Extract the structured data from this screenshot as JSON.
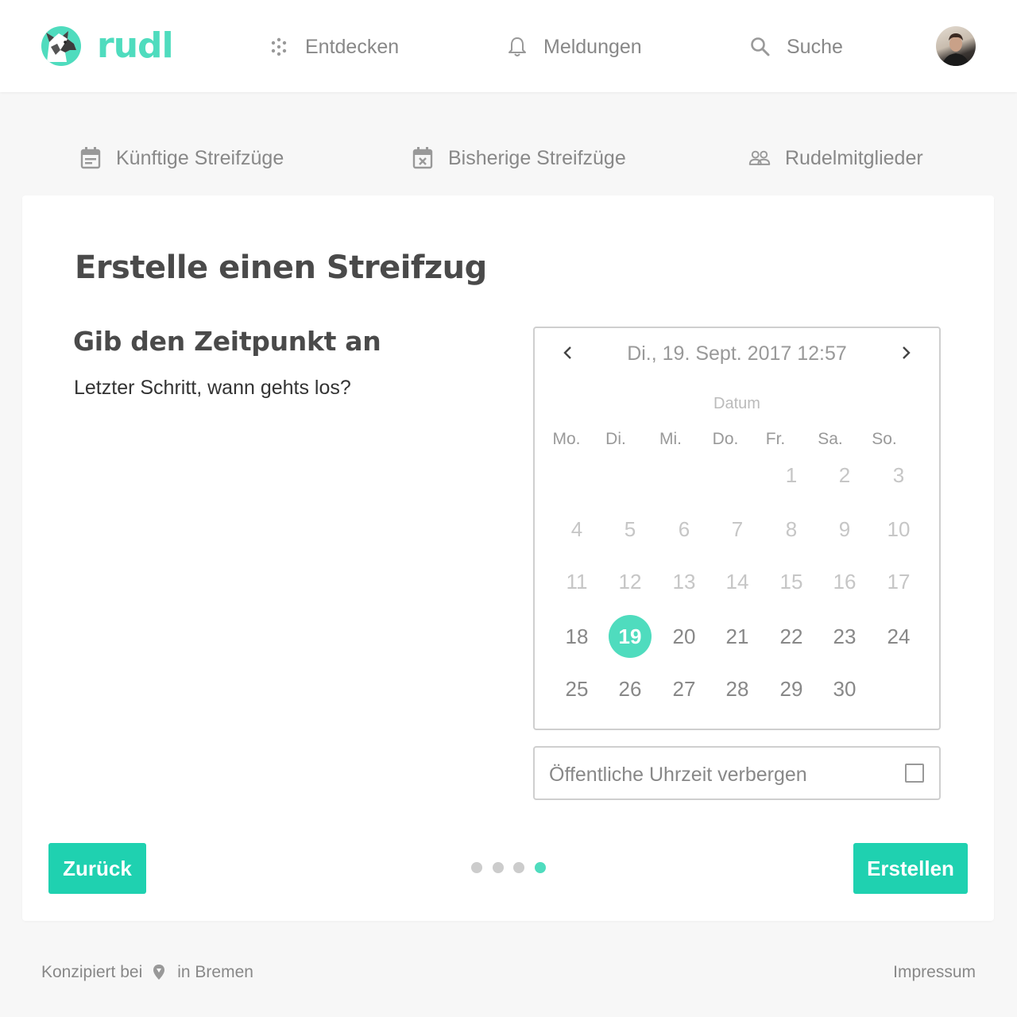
{
  "header": {
    "brand": "rudl",
    "nav": {
      "discover": "Entdecken",
      "notifications": "Meldungen",
      "search": "Suche"
    },
    "accent_color": "#4fdcbe"
  },
  "tabs": {
    "upcoming": "Künftige Streifzüge",
    "past": "Bisherige Streifzüge",
    "members": "Rudelmitglieder"
  },
  "form": {
    "title": "Erstelle einen Streifzug",
    "step_title": "Gib den Zeitpunkt an",
    "step_subtitle": "Letzter Schritt, wann gehts los?"
  },
  "calendar": {
    "header": "Di., 19. Sept. 2017 12:57",
    "section_label": "Datum",
    "weekdays": [
      "Mo.",
      "Di.",
      "Mi.",
      "Do.",
      "Fr.",
      "Sa.",
      "So."
    ],
    "first_weekday_index": 4,
    "days_in_month": 30,
    "selected_day": 19
  },
  "toggle": {
    "label": "Öffentliche Uhrzeit verbergen",
    "checked": false
  },
  "buttons": {
    "back": "Zurück",
    "create": "Erstellen",
    "color": "#1fd1b0"
  },
  "steps": {
    "total": 4,
    "current": 4
  },
  "footer": {
    "left_prefix": "Konzipiert bei",
    "left_suffix": "in Bremen",
    "imprint": "Impressum"
  }
}
